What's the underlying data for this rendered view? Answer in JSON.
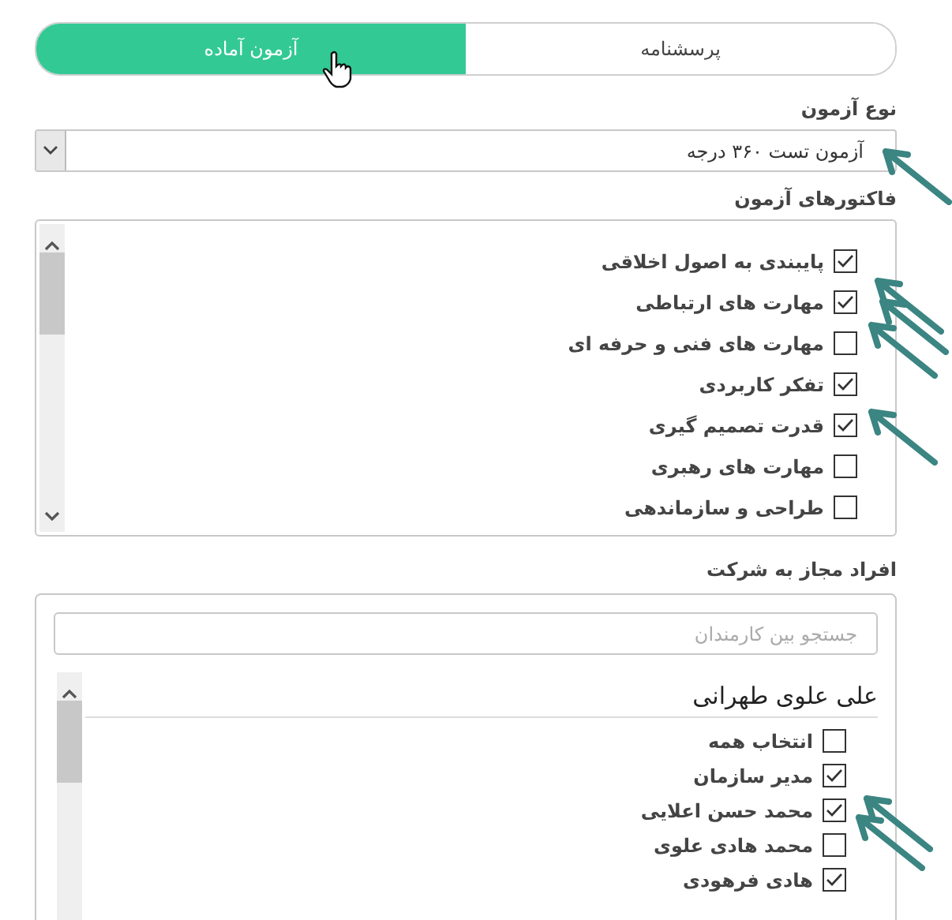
{
  "tabs": [
    {
      "label": "پرسشنامه",
      "selected": false
    },
    {
      "label": "آزمون آماده",
      "selected": true
    }
  ],
  "exam_type": {
    "label": "نوع آزمون",
    "value": "آزمون تست ۳۶۰ درجه"
  },
  "factors": {
    "label": "فاکتورهای آزمون",
    "items": [
      {
        "label": "پایبندی به اصول اخلاقی",
        "checked": true
      },
      {
        "label": "مهارت های ارتباطی",
        "checked": true
      },
      {
        "label": "مهارت های فنی و حرفه ای",
        "checked": false
      },
      {
        "label": "تفکر کاربردی",
        "checked": true
      },
      {
        "label": "قدرت تصمیم گیری",
        "checked": true
      },
      {
        "label": "مهارت های رهبری",
        "checked": false
      },
      {
        "label": "طراحی و سازماندهی",
        "checked": false
      }
    ]
  },
  "participants": {
    "label": "افراد مجاز به شرکت",
    "search": {
      "placeholder": "جستجو بین کارمندان"
    },
    "groups": [
      {
        "name": "علی علوی طهرانی",
        "items": [
          {
            "label": "انتخاب همه",
            "checked": false
          },
          {
            "label": "مدیر سازمان",
            "checked": true
          },
          {
            "label": "محمد حسن اعلایی",
            "checked": true
          },
          {
            "label": "محمد هادی علوی",
            "checked": false
          },
          {
            "label": "هادی فرهودی",
            "checked": true
          }
        ]
      }
    ]
  }
}
